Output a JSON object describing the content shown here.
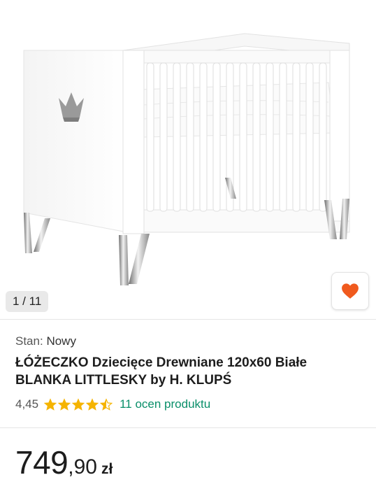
{
  "gallery": {
    "counter": "1 / 11",
    "image_icon": "crib-photo",
    "favorite_icon": "heart-icon",
    "favorite_color": "#f05a1e"
  },
  "product": {
    "condition_label": "Stan:",
    "condition_value": "Nowy",
    "title_line1": "ŁÓŻECZKO Dziecięce Drewniane 120x60 Białe",
    "title_line2": "BLANKA LITTLESKY by H. KLUPŚ",
    "rating_value": "4,45",
    "rating_stars": 4.45,
    "star_color": "#f5b400",
    "reviews_link": "11 ocen produktu",
    "price_int": "749",
    "price_dec": ",90",
    "currency": "zł"
  }
}
